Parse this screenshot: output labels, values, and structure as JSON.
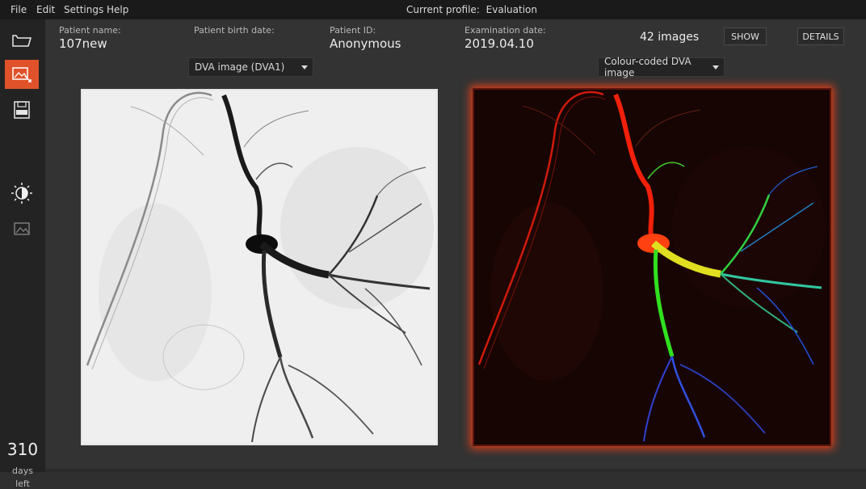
{
  "menu": {
    "items": [
      "File",
      "Edit",
      "Settings",
      "Help"
    ],
    "profile_label": "Current profile:",
    "profile_value": "Evaluation"
  },
  "sidebar": {
    "buttons": [
      {
        "name": "open-folder",
        "icon": "folder-icon",
        "active": false
      },
      {
        "name": "image-process",
        "icon": "image-edit-icon",
        "active": true
      },
      {
        "name": "save-dicom",
        "icon": "dicom-save-icon",
        "active": false
      },
      {
        "name": "contrast",
        "icon": "contrast-icon",
        "active": false
      },
      {
        "name": "image-view",
        "icon": "image-icon",
        "active": false
      }
    ],
    "days_number": "310",
    "days_label_1": "days",
    "days_label_2": "left"
  },
  "patient": {
    "name_label": "Patient name:",
    "name_value": "107new",
    "birth_label": "Patient birth date:",
    "id_label": "Patient ID:",
    "id_value": "Anonymous",
    "exam_label": "Examination date:",
    "exam_value": "2019.04.10"
  },
  "images": {
    "count": "42 images",
    "show_label": "SHOW",
    "details_label": "DETAILS"
  },
  "views": {
    "left_select": "DVA image (DVA1)",
    "right_select": "Colour-coded DVA image"
  },
  "colors": {
    "accent": "#e0522a",
    "glow": "#e0401a"
  }
}
